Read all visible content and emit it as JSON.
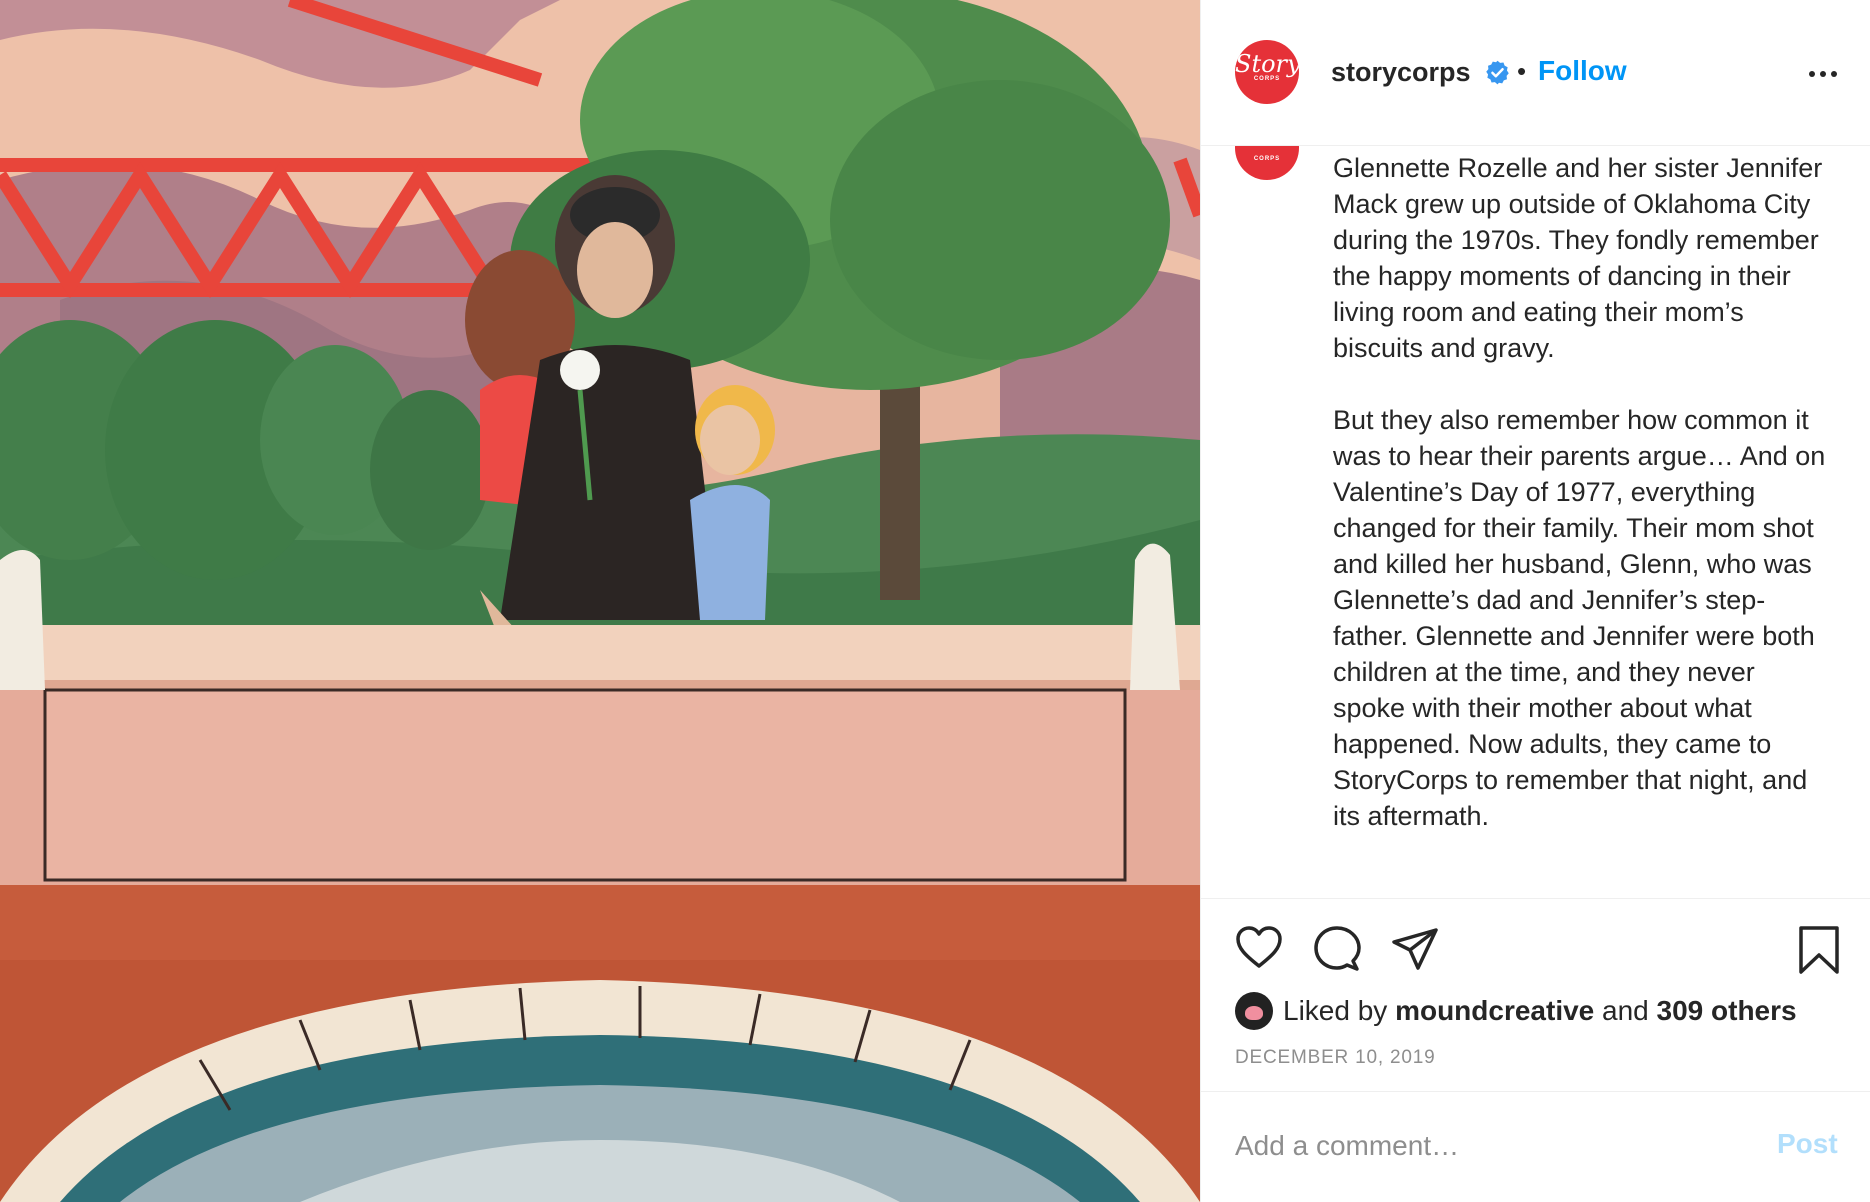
{
  "post": {
    "username": "storycorps",
    "avatar_text": "Story",
    "avatar_subtext": "CORPS",
    "follow_label": "Follow",
    "separator": "•",
    "caption": "Glennette Rozelle and her sister Jennifer Mack grew up outside of Oklahoma City during the 1970s. They fondly remember the happy moments of dancing in their living room and eating their mom’s biscuits and gravy.\n\nBut they also remember how common it was to hear their parents argue… And on Valentine’s Day of 1977, everything changed for their family. Their mom shot and killed her husband, Glenn, who was Glennette’s dad and Jennifer’s step-father. Glennette and Jennifer were both children at the time, and they never spoke with their mother about what happened. Now adults, they came to StoryCorps to remember that night, and its aftermath.",
    "likes": {
      "prefix": "Liked by",
      "user": "moundcreative",
      "joiner": "and",
      "others": "309 others"
    },
    "date": "DECEMBER 10, 2019",
    "comment_placeholder": "Add a comment…",
    "post_label": "Post"
  },
  "icons": {
    "verified": "verified-badge-icon",
    "more": "more-options-icon",
    "like": "heart-icon",
    "comment": "comment-bubble-icon",
    "share": "paper-plane-icon",
    "save": "bookmark-icon"
  },
  "colors": {
    "brand_red": "#e53138",
    "link_blue": "#0095f6",
    "post_disabled": "#b2dffc",
    "muted": "#8e8e8e",
    "text": "#262626"
  }
}
